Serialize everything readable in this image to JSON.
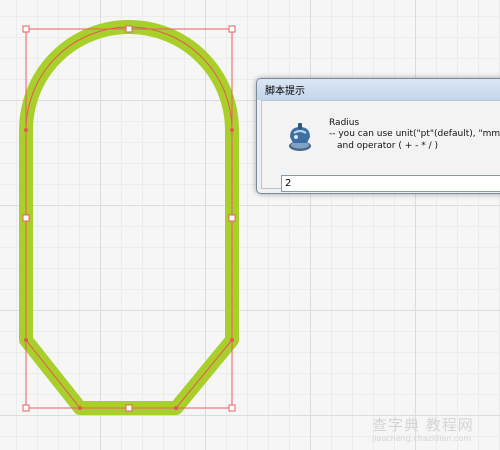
{
  "dialog": {
    "title": "脚本提示",
    "message_title": "Radius",
    "message_line1": "-- you can use unit(\"pt\"(default), \"mm\", \"in",
    "message_line2": "and operator ( + - * / )",
    "input_value": "2"
  },
  "watermark": {
    "main": "查字典 教程网",
    "sub": "jiaocheng.chazidian.com"
  },
  "colors": {
    "shape_stroke": "#a8cf2a",
    "path_outline": "#e85555",
    "selection_box": "#e86060",
    "dialog_title_bg": "#c8d8ec"
  },
  "icons": {
    "dialog_icon": "script-icon"
  }
}
